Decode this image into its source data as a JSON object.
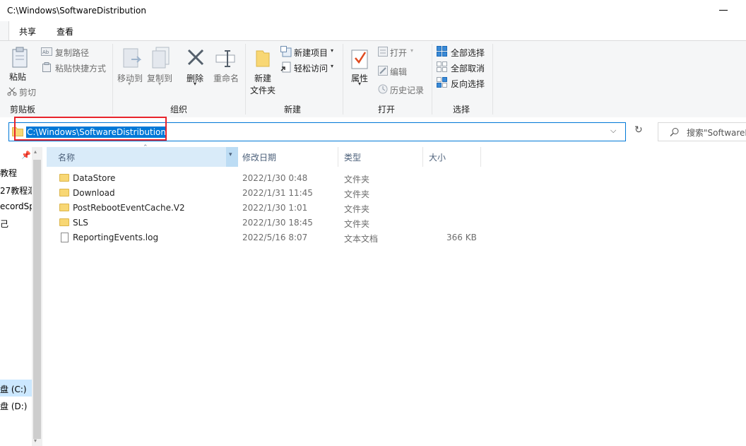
{
  "window": {
    "title": "C:\\Windows\\SoftwareDistribution"
  },
  "tabs": [
    "共享",
    "查看"
  ],
  "ribbon": {
    "clipboard": {
      "paste": "粘贴",
      "cut": "剪切",
      "copy_path": "复制路径",
      "paste_shortcut": "粘贴快捷方式",
      "group": "剪贴板"
    },
    "organize": {
      "move_to": "移动到",
      "copy_to": "复制到",
      "delete": "删除",
      "rename": "重命名",
      "group": "组织"
    },
    "new": {
      "new_folder_1": "新建",
      "new_folder_2": "文件夹",
      "new_item": "新建项目",
      "easy_access": "轻松访问",
      "group": "新建"
    },
    "open": {
      "properties": "属性",
      "open": "打开",
      "edit": "编辑",
      "history": "历史记录",
      "group": "打开"
    },
    "select": {
      "select_all": "全部选择",
      "select_none": "全部取消",
      "invert": "反向选择",
      "group": "选择"
    }
  },
  "address": {
    "path": "C:\\Windows\\SoftwareDistribution"
  },
  "search": {
    "placeholder": "搜索\"SoftwareD"
  },
  "nav": {
    "items": [
      {
        "label": "教程"
      },
      {
        "label": "27教程汇"
      },
      {
        "label": "ecordSp"
      },
      {
        "label": "己"
      },
      {
        "label": "盘 (C:)"
      },
      {
        "label": "盘 (D:)"
      }
    ]
  },
  "columns": {
    "name": "名称",
    "modified": "修改日期",
    "type": "类型",
    "size": "大小"
  },
  "files": [
    {
      "name": "DataStore",
      "modified": "2022/1/30 0:48",
      "type": "文件夹",
      "size": "",
      "icon": "folder-icon"
    },
    {
      "name": "Download",
      "modified": "2022/1/31 11:45",
      "type": "文件夹",
      "size": "",
      "icon": "folder-icon"
    },
    {
      "name": "PostRebootEventCache.V2",
      "modified": "2022/1/30 1:01",
      "type": "文件夹",
      "size": "",
      "icon": "folder-icon"
    },
    {
      "name": "SLS",
      "modified": "2022/1/30 18:45",
      "type": "文件夹",
      "size": "",
      "icon": "folder-icon"
    },
    {
      "name": "ReportingEvents.log",
      "modified": "2022/5/16 8:07",
      "type": "文本文档",
      "size": "366 KB",
      "icon": "document-icon"
    }
  ]
}
